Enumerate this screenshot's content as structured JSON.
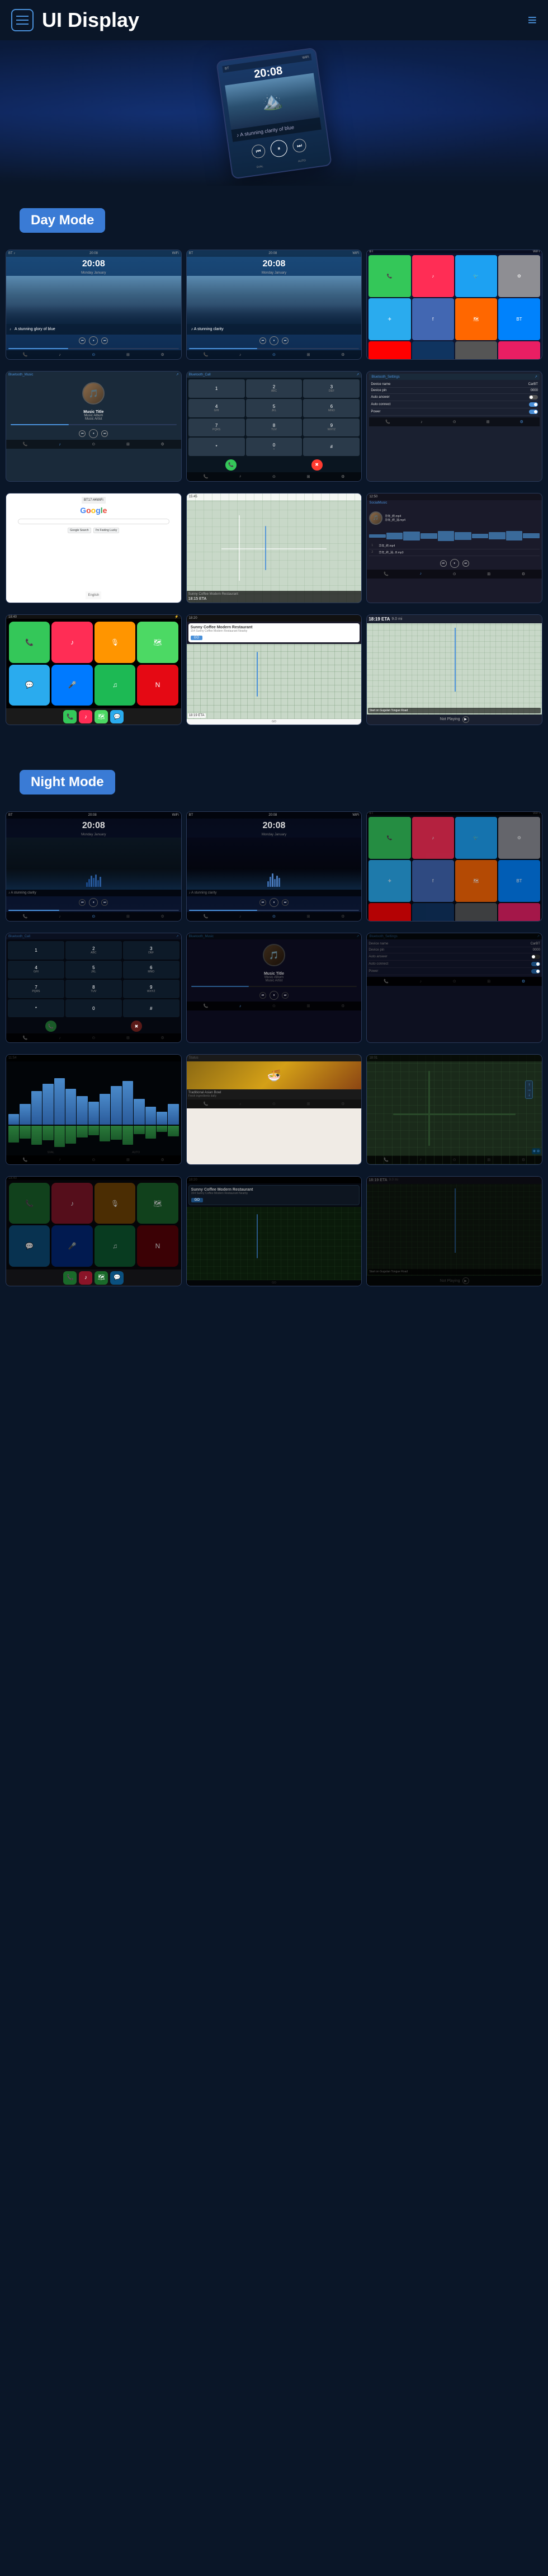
{
  "header": {
    "title": "UI Display",
    "hamburger_label": "menu",
    "menu_label": "navigation menu"
  },
  "sections": {
    "day_mode": {
      "label": "Day Mode",
      "screens": [
        {
          "id": "day-home-1",
          "type": "home",
          "time": "20:08",
          "subtitle": "Monday January"
        },
        {
          "id": "day-home-2",
          "type": "home",
          "time": "20:08",
          "subtitle": "Monday January"
        },
        {
          "id": "day-apps",
          "type": "apps"
        },
        {
          "id": "day-music",
          "type": "music",
          "title": "Music Title",
          "album": "Music Album",
          "artist": "Music Artist"
        },
        {
          "id": "day-phone",
          "type": "phone"
        },
        {
          "id": "day-settings",
          "type": "settings",
          "device_name": "CarBT",
          "device_pin": "0000"
        },
        {
          "id": "day-google",
          "type": "google"
        },
        {
          "id": "day-map",
          "type": "map"
        },
        {
          "id": "day-local-music",
          "type": "local-music"
        }
      ]
    },
    "carplay": {
      "screens": [
        {
          "id": "cp-home-1",
          "type": "carplay-home"
        },
        {
          "id": "cp-nav",
          "type": "carplay-nav",
          "place": "Sunny Coffee Modern Restaurant",
          "address": "154 Sunny Coffee\nModern Restaurant Nearby"
        },
        {
          "id": "cp-map",
          "type": "carplay-map",
          "eta": "18:19 ETA",
          "distance": "9.0 mi"
        },
        {
          "id": "cp-not-playing",
          "type": "carplay-music",
          "status": "Not Playing"
        }
      ]
    },
    "night_mode": {
      "label": "Night Mode",
      "screens": [
        {
          "id": "night-home-1",
          "type": "home-night",
          "time": "20:08"
        },
        {
          "id": "night-home-2",
          "type": "home-night",
          "time": "20:08"
        },
        {
          "id": "night-apps",
          "type": "apps-night"
        },
        {
          "id": "night-phone",
          "type": "phone-night"
        },
        {
          "id": "night-music",
          "type": "music-night",
          "title": "Music Title",
          "album": "Music Album",
          "artist": "Music Artist"
        },
        {
          "id": "night-settings",
          "type": "settings-night"
        },
        {
          "id": "night-eq",
          "type": "eq-night"
        },
        {
          "id": "night-food",
          "type": "food-night"
        },
        {
          "id": "night-road",
          "type": "road-night"
        },
        {
          "id": "night-carplay-1",
          "type": "carplay-night-1"
        },
        {
          "id": "night-carplay-nav",
          "type": "carplay-night-nav"
        },
        {
          "id": "night-carplay-music",
          "type": "carplay-night-music"
        }
      ]
    }
  },
  "app_colors": {
    "phone": "#34c759",
    "music": "#ff2d55",
    "maps": "#4cd964",
    "messages": "#34c759",
    "telegram": "#2aabee",
    "youtube": "#ff0000",
    "bt": "#0082fc",
    "settings": "#8e8e93",
    "camera": "#555555",
    "safari": "#006cff"
  },
  "music_player": {
    "title": "Music Title",
    "album": "Music Album",
    "artist": "Music Artist",
    "progress": 35
  },
  "settings": {
    "device_name_label": "Device name",
    "device_name_value": "CarBT",
    "device_pin_label": "Device pin",
    "device_pin_value": "0000",
    "auto_answer_label": "Auto answer",
    "auto_connect_label": "Auto connect",
    "power_label": "Power"
  },
  "navigation": {
    "place": "Sunny Coffee Modern Restaurant",
    "address": "154 Sunny Coffee Modern Restaurant Nearby",
    "eta": "18:19 ETA",
    "distance": "9.0 mi",
    "go_label": "GO",
    "start_label": "Start on Gugulan Tongue Road"
  },
  "phone_keys": [
    [
      "1",
      "2 ABC",
      "3 DEF"
    ],
    [
      "4 GHI",
      "5 JKL",
      "6 MNO"
    ],
    [
      "7 PQRS",
      "8 TUV",
      "9 WXYZ"
    ],
    [
      "*",
      "0 +",
      "#"
    ]
  ]
}
